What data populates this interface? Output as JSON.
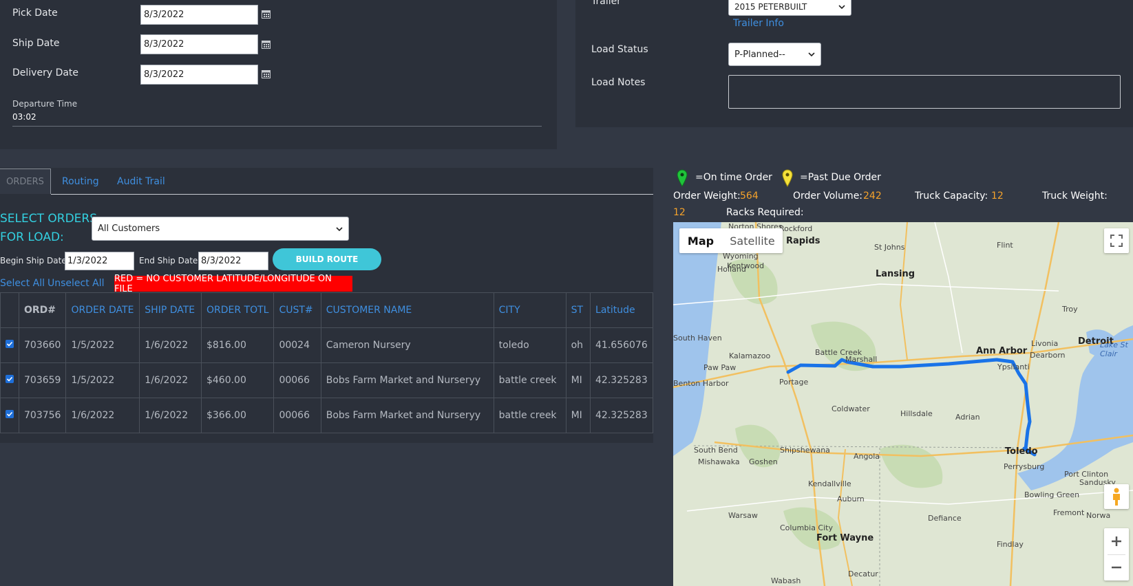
{
  "form": {
    "pick_date_label": "Pick Date",
    "pick_date": "8/3/2022",
    "ship_date_label": "Ship Date",
    "ship_date": "8/3/2022",
    "delivery_date_label": "Delivery Date",
    "delivery_date": "8/3/2022",
    "departure_time_label": "Departure Time",
    "departure_time": "03:02"
  },
  "load": {
    "trailer_label": "Trailer",
    "trailer_value": "2015 PETERBUILT",
    "trailer_info_link": "Trailer Info",
    "load_status_label": "Load Status",
    "load_status_value": "P-Planned--",
    "load_notes_label": "Load Notes"
  },
  "tabs": [
    {
      "label": "ORDERS"
    },
    {
      "label": "Routing"
    },
    {
      "label": "Audit Trail"
    }
  ],
  "orders": {
    "title_line1": "SELECT ORDERS",
    "title_line2": "FOR LOAD:",
    "customer_filter": "All Customers",
    "begin_ship_label": "Begin Ship Date:",
    "begin_ship_value": "1/3/2022",
    "end_ship_label": "End Ship Date:",
    "end_ship_value": "8/3/2022",
    "build_route": "BUILD ROUTE",
    "select_all": "Select All",
    "unselect_all": "Unselect All",
    "warning": "RED = NO CUSTOMER LATITUDE/LONGITUDE ON FILE",
    "columns": [
      "ORD#",
      "ORDER DATE",
      "SHIP DATE",
      "ORDER TOTL",
      "CUST#",
      "CUSTOMER NAME",
      "CITY",
      "ST",
      "Latitude"
    ],
    "rows": [
      {
        "ord": "703660",
        "order_date": "1/5/2022",
        "ship_date": "1/6/2022",
        "total": "$816.00",
        "cust": "00024",
        "name": "Cameron Nursery",
        "city": "toledo",
        "st": "oh",
        "lat": "41.656076"
      },
      {
        "ord": "703659",
        "order_date": "1/5/2022",
        "ship_date": "1/6/2022",
        "total": "$460.00",
        "cust": "00066",
        "name": "Bobs Farm Market and Nurseryy",
        "city": "battle creek",
        "st": "MI",
        "lat": "42.325283"
      },
      {
        "ord": "703756",
        "order_date": "1/6/2022",
        "ship_date": "1/6/2022",
        "total": "$366.00",
        "cust": "00066",
        "name": "Bobs Farm Market and Nurseryy",
        "city": "battle creek",
        "st": "MI",
        "lat": "42.325283"
      }
    ]
  },
  "legend": {
    "on_time": "=On time Order",
    "past_due": "=Past Due Order",
    "on_time_color": "#1fc43a",
    "past_due_color": "#f5e13a"
  },
  "stats": {
    "order_weight_label": "Order Weight:",
    "order_weight": "564",
    "order_volume_label": "Order Volume:",
    "order_volume": "242",
    "truck_capacity_label": "Truck Capacity:",
    "truck_capacity": "12",
    "truck_weight_label": "Truck Weight:",
    "truck_weight": "12",
    "racks_required_label": "Racks Required:"
  },
  "map": {
    "map_button": "Map",
    "satellite_button": "Satellite",
    "route_color": "#1a73e8",
    "cities": [
      {
        "name": "Grand Rapids",
        "big": true
      },
      {
        "name": "Lansing",
        "big": true
      },
      {
        "name": "Ann Arbor",
        "big": true
      },
      {
        "name": "Detroit",
        "big": true
      },
      {
        "name": "Toledo",
        "big": true
      },
      {
        "name": "Fort Wayne",
        "big": true
      },
      {
        "name": "Kalamazoo",
        "big": false
      },
      {
        "name": "Battle Creek",
        "big": false
      },
      {
        "name": "Portage",
        "big": false
      },
      {
        "name": "Marshall",
        "big": false
      },
      {
        "name": "Ypsilanti",
        "big": false
      },
      {
        "name": "Coldwater",
        "big": false
      },
      {
        "name": "Hillsdale",
        "big": false
      },
      {
        "name": "Adrian",
        "big": false
      },
      {
        "name": "South Bend",
        "big": false
      },
      {
        "name": "Goshen",
        "big": false
      },
      {
        "name": "Angola",
        "big": false
      },
      {
        "name": "Perrysburg",
        "big": false
      },
      {
        "name": "Bowling Green",
        "big": false
      },
      {
        "name": "Holland",
        "big": false
      },
      {
        "name": "South Haven",
        "big": false
      },
      {
        "name": "Flint",
        "big": false
      },
      {
        "name": "Troy",
        "big": false
      },
      {
        "name": "Livonia",
        "big": false
      },
      {
        "name": "Dearborn",
        "big": false
      },
      {
        "name": "St Johns",
        "big": false
      },
      {
        "name": "Rockford",
        "big": false
      },
      {
        "name": "Wyoming",
        "big": false
      },
      {
        "name": "Kentwood",
        "big": false
      },
      {
        "name": "Paw Paw",
        "big": false
      },
      {
        "name": "Mishawaka",
        "big": false
      },
      {
        "name": "Shipshewana",
        "big": false
      },
      {
        "name": "Kendallville",
        "big": false
      },
      {
        "name": "Auburn",
        "big": false
      },
      {
        "name": "Warsaw",
        "big": false
      },
      {
        "name": "Columbia City",
        "big": false
      },
      {
        "name": "Defiance",
        "big": false
      },
      {
        "name": "Findlay",
        "big": false
      },
      {
        "name": "Fremont",
        "big": false
      },
      {
        "name": "Port Clinton",
        "big": false
      },
      {
        "name": "Sandusky",
        "big": false
      },
      {
        "name": "Lake St Clair",
        "big": false
      },
      {
        "name": "Norton Shores",
        "big": false
      },
      {
        "name": "Benton Harbor",
        "big": false
      },
      {
        "name": "Wabash",
        "big": false
      },
      {
        "name": "Decatur",
        "big": false
      },
      {
        "name": "Norwa",
        "big": false
      }
    ]
  }
}
